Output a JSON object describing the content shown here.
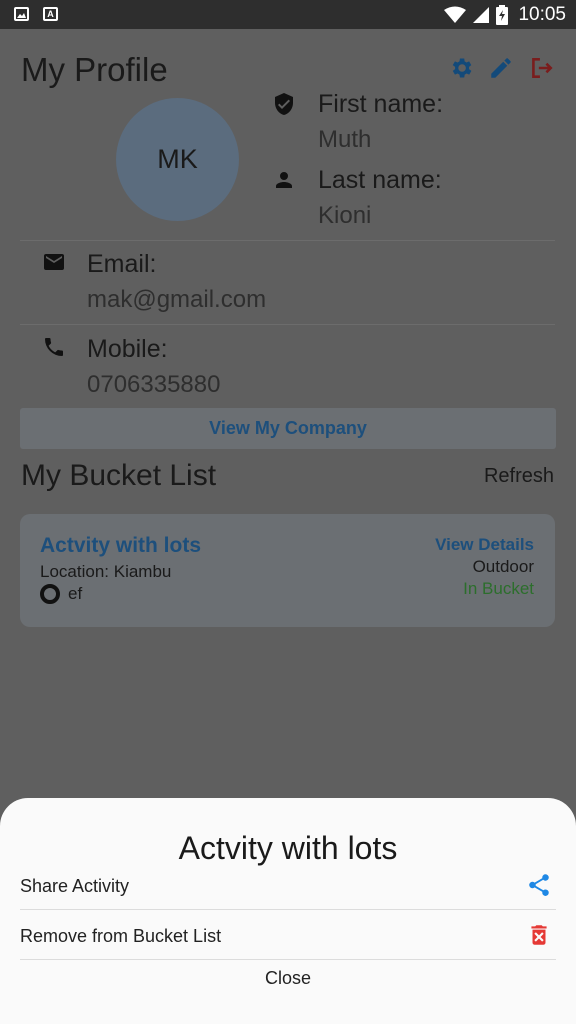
{
  "status_bar": {
    "time": "10:05"
  },
  "profile": {
    "title": "My Profile",
    "initials": "MK",
    "first_name_label": "First name:",
    "first_name": "Muth",
    "last_name_label": "Last name:",
    "last_name": "Kioni",
    "email_label": "Email:",
    "email": "mak@gmail.com",
    "mobile_label": "Mobile:",
    "mobile": "0706335880",
    "company_button": "View My Company"
  },
  "bucket": {
    "title": "My Bucket List",
    "refresh_label": "Refresh",
    "card": {
      "title": "Actvity with lots",
      "location_label": "Location:",
      "location": "Kiambu",
      "status": "ef",
      "details_label": "View Details",
      "type": "Outdoor",
      "bucket_status": "In Bucket"
    }
  },
  "sheet": {
    "title": "Actvity with lots",
    "share_label": "Share Activity",
    "remove_label": "Remove from Bucket List",
    "close_label": "Close"
  },
  "colors": {
    "accent_blue": "#1e88e5",
    "danger_red": "#e53935",
    "success_green": "#2e7d32"
  },
  "icons": [
    "image-icon",
    "font-icon",
    "wifi-icon",
    "signal-icon",
    "battery-icon",
    "gear-icon",
    "pencil-icon",
    "logout-icon",
    "shield-icon",
    "person-icon",
    "mail-icon",
    "phone-icon",
    "share-icon",
    "trash-icon"
  ]
}
